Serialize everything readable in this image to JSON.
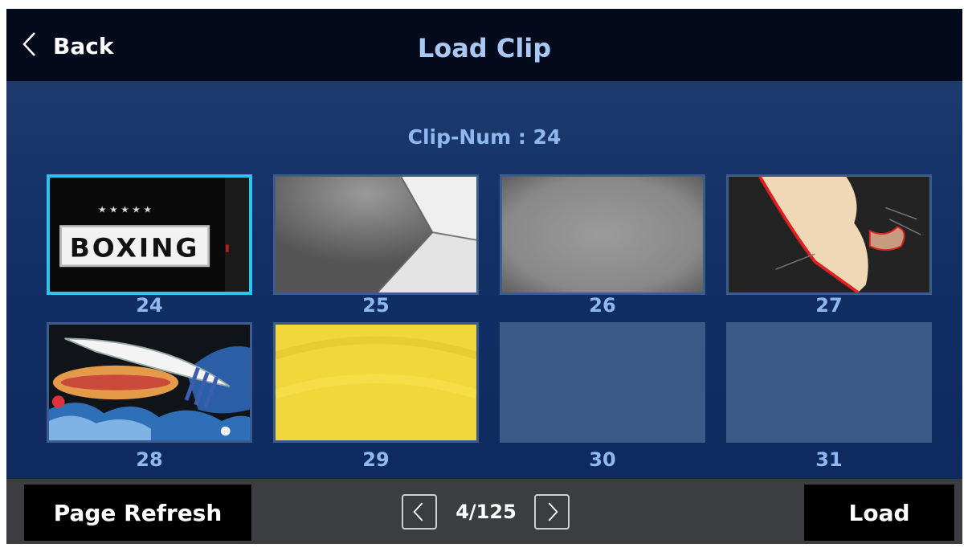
{
  "header": {
    "back_label": "Back",
    "title": "Load Clip"
  },
  "clip_num_label": "Clip-Num : 24",
  "clips": [
    {
      "number": "24",
      "thumb_text": "BOXING",
      "selected": true
    },
    {
      "number": "25"
    },
    {
      "number": "26"
    },
    {
      "number": "27"
    },
    {
      "number": "28"
    },
    {
      "number": "29"
    },
    {
      "number": "30",
      "empty": true
    },
    {
      "number": "31",
      "empty": true
    }
  ],
  "footer": {
    "refresh_label": "Page Refresh",
    "pager": "4/125",
    "load_label": "Load"
  },
  "colors": {
    "selection": "#2fc3f2",
    "title": "#a9c8f4",
    "tile_empty": "#3d5988"
  },
  "icons": {
    "back": "chevron-left-icon",
    "prev": "chevron-left-icon",
    "next": "chevron-right-icon"
  }
}
